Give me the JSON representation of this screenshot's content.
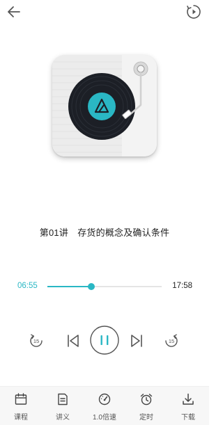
{
  "header": {
    "back_icon": "arrow-left-icon",
    "timer_icon": "circular-timer-icon"
  },
  "album": {
    "art": "turntable-record-icon",
    "accent_color": "#2ab7c4"
  },
  "lesson": {
    "title": "第01讲　存货的概念及确认条件"
  },
  "player": {
    "current_time": "06:55",
    "total_time": "17:58",
    "progress_fraction": 0.385,
    "rewind_label": "15",
    "forward_label": "15",
    "state": "playing"
  },
  "colors": {
    "accent": "#2ab7c4",
    "icon_gray": "#555555"
  },
  "bottom_nav": {
    "items": [
      {
        "label": "课程",
        "icon": "calendar-icon"
      },
      {
        "label": "讲义",
        "icon": "document-icon"
      },
      {
        "label": "1.0倍速",
        "icon": "speedometer-icon"
      },
      {
        "label": "定时",
        "icon": "alarm-clock-icon"
      },
      {
        "label": "下载",
        "icon": "download-icon"
      }
    ]
  }
}
